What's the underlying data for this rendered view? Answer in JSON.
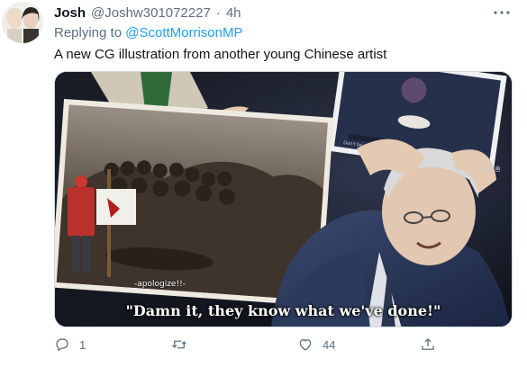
{
  "tweet": {
    "author_name": "Josh",
    "author_handle": "@Joshw301072227",
    "separator": "·",
    "time": "4h",
    "more_icon": "more-horizontal-icon",
    "replying_prefix": "Replying to",
    "replying_to": "@ScottMorrisonMP",
    "text": "A new CG illustration from another young Chinese artist",
    "media": {
      "caption": "\"Damn it, they know what we've done!\"",
      "sub_caption": "-apologize!!-",
      "painting_text": "Don't be afraid",
      "watermark": "大鱼舍"
    },
    "actions": {
      "reply_count": "1",
      "retweet_count": "",
      "like_count": "44",
      "share_count": "",
      "reply_icon": "reply-icon",
      "retweet_icon": "retweet-icon",
      "like_icon": "heart-icon",
      "share_icon": "share-icon"
    },
    "colors": {
      "link": "#1da1f2",
      "secondary": "#5b7083",
      "text": "#0f1419"
    }
  }
}
